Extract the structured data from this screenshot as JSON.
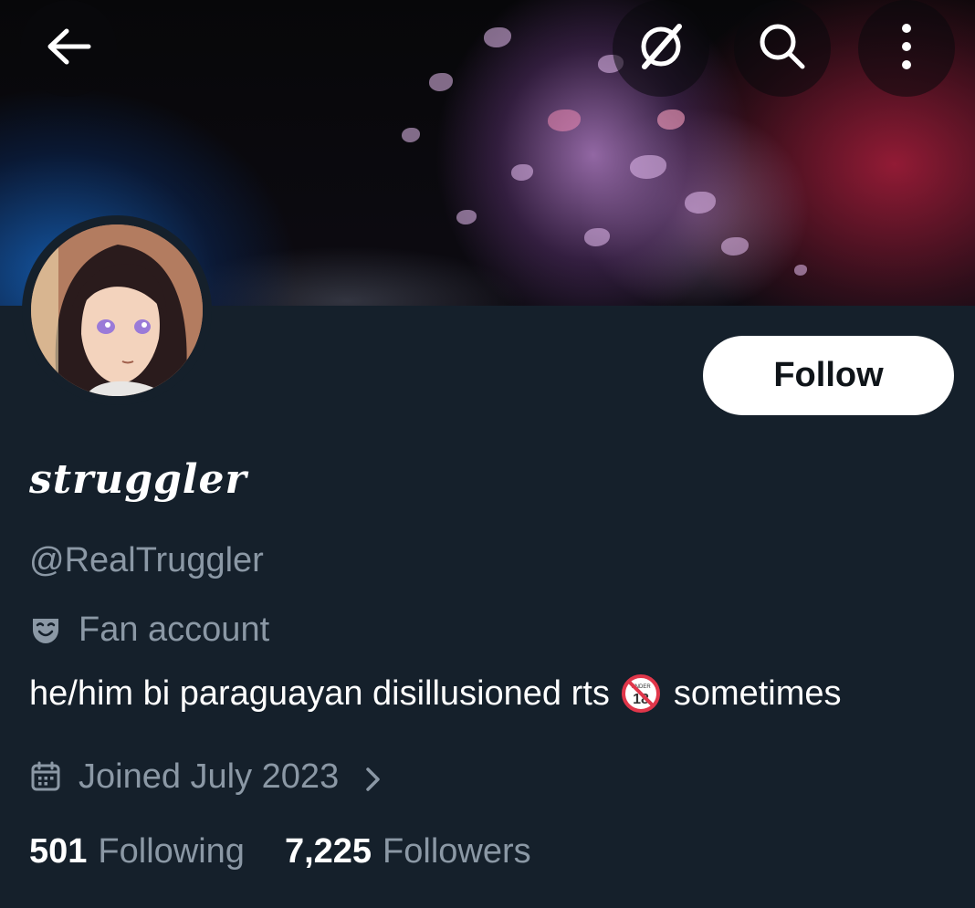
{
  "header": {
    "back_icon": "arrow-left-icon",
    "grok_icon": "grok-icon",
    "search_icon": "search-icon",
    "more_icon": "more-vertical-icon"
  },
  "profile": {
    "display_name": "struggler",
    "handle": "@RealTruggler",
    "category_icon": "theater-masks-icon",
    "category": "Fan account",
    "bio_prefix": "he/him bi paraguayan disillusioned rts",
    "bio_emoji": "🔞",
    "bio_suffix": "sometimes",
    "joined_icon": "calendar-icon",
    "joined": "Joined July 2023"
  },
  "actions": {
    "follow_label": "Follow"
  },
  "stats": {
    "following_count": "501",
    "following_label": "Following",
    "followers_count": "7,225",
    "followers_label": "Followers"
  },
  "colors": {
    "background": "#15202b",
    "secondary_text": "#8b98a5",
    "primary_text": "#ffffff",
    "follow_button_bg": "#ffffff",
    "follow_button_text": "#0f1419",
    "no_under_18_red": "#e0364a"
  }
}
